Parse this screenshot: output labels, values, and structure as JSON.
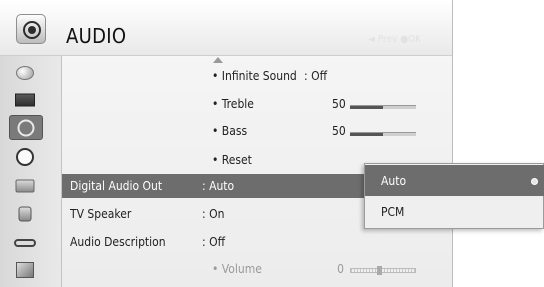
{
  "header": {
    "title": "AUDIO",
    "faint_hint": "◄ Prev ●OK"
  },
  "sidebar": {
    "items": [
      {
        "icon": "picture-icon",
        "selected": false
      },
      {
        "icon": "tv-screen-icon",
        "selected": false
      },
      {
        "icon": "audio-speaker-icon",
        "selected": true
      },
      {
        "icon": "clock-icon",
        "selected": false
      },
      {
        "icon": "briefcase-icon",
        "selected": false
      },
      {
        "icon": "lock-icon",
        "selected": false
      },
      {
        "icon": "input-cable-icon",
        "selected": false
      },
      {
        "icon": "support-icon",
        "selected": false
      }
    ]
  },
  "main": {
    "infinite_sound": {
      "label": "• Infinite Sound",
      "value": ": Off"
    },
    "treble": {
      "label": "• Treble",
      "value": "50",
      "level": 0.5
    },
    "bass": {
      "label": "• Bass",
      "value": "50",
      "level": 0.5
    },
    "reset": {
      "label": "• Reset"
    },
    "digital_audio_out": {
      "label": "Digital Audio Out",
      "value": ": Auto"
    },
    "tv_speaker": {
      "label": "TV Speaker",
      "value": ": On"
    },
    "audio_description": {
      "label": "Audio Description",
      "value": ": Off"
    },
    "volume": {
      "label": "• Volume",
      "value": "0"
    }
  },
  "popup": {
    "options": [
      "Auto",
      "PCM"
    ],
    "selected": "Auto"
  },
  "colors": {
    "highlight": "#6d6d6d",
    "panel": "#ececec",
    "text": "#222222"
  }
}
